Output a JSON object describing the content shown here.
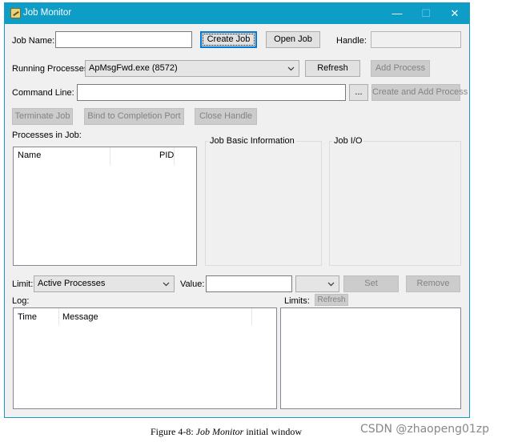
{
  "window": {
    "title": "Job Monitor",
    "minimize": "—",
    "maximize": "☐",
    "close": "✕"
  },
  "job_name": {
    "label": "Job Name:",
    "value": ""
  },
  "buttons": {
    "create_job": "Create Job",
    "open_job": "Open Job",
    "refresh": "Refresh",
    "add_process": "Add Process",
    "browse": "...",
    "create_and_add": "Create and Add Process",
    "terminate_job": "Terminate Job",
    "bind_port": "Bind to Completion Port",
    "close_handle": "Close Handle",
    "set": "Set",
    "remove": "Remove",
    "limits_refresh": "Refresh"
  },
  "handle": {
    "label": "Handle:",
    "value": ""
  },
  "running_processes": {
    "label": "Running Processes:",
    "selected": "ApMsgFwd.exe (8572)"
  },
  "command_line": {
    "label": "Command Line:",
    "value": ""
  },
  "processes_in_job": {
    "label": "Processes in Job:",
    "columns": [
      "Name",
      "PID"
    ]
  },
  "groups": {
    "basic_info": "Job Basic Information",
    "job_io": "Job I/O"
  },
  "limit": {
    "label": "Limit:",
    "selected": "Active Processes"
  },
  "value": {
    "label": "Value:",
    "value": "",
    "unit_selected": ""
  },
  "log": {
    "label": "Log:",
    "columns": [
      "Time",
      "Message"
    ]
  },
  "limits": {
    "label": "Limits:"
  },
  "caption": {
    "prefix": "Figure 4-8: ",
    "italic": "Job Monitor",
    "suffix": " initial window"
  },
  "watermark": "CSDN @zhaopeng01zp"
}
